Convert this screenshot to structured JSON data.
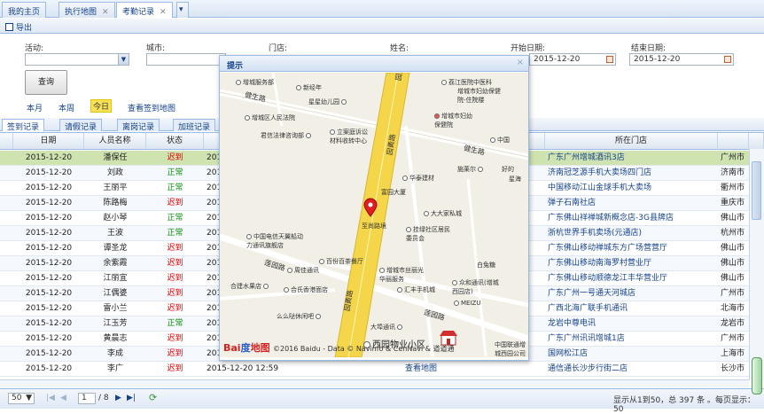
{
  "tabs": [
    {
      "label": "我的主页"
    },
    {
      "label": "执行地图"
    },
    {
      "label": "考勤记录"
    }
  ],
  "toolbar": {
    "export_label": "导出"
  },
  "filter": {
    "activity_label": "活动:",
    "city_label": "城市:",
    "store_label": "门店:",
    "name_label": "姓名:",
    "start_label": "开始日期:",
    "start_value": "2015-12-20",
    "end_label": "结束日期:",
    "end_value": "2015-12-20",
    "query_label": "查询",
    "month_link": "本月",
    "week_link": "本周",
    "today_link": "今日",
    "map_link": "查看签到地图"
  },
  "subtabs": [
    {
      "label": "签到记录"
    },
    {
      "label": "请假记录"
    },
    {
      "label": "离岗记录"
    },
    {
      "label": "加班记录"
    }
  ],
  "grid": {
    "columns": [
      "日期",
      "人员名称",
      "状态",
      "",
      "所在门店"
    ],
    "rows": [
      {
        "date": "2015-12-20",
        "name": "潘保任",
        "status": "迟到",
        "time": "201",
        "store": "广东广州增城酒讯3店",
        "city": "广州市"
      },
      {
        "date": "2015-12-20",
        "name": "刘政",
        "status": "正常",
        "time": "201",
        "store": "济南冠芝源手机大卖场四门店",
        "city": "济南市"
      },
      {
        "date": "2015-12-20",
        "name": "王丽平",
        "status": "正常",
        "time": "201",
        "store": "中国移动江山金球手机大卖场",
        "city": "衢州市"
      },
      {
        "date": "2015-12-20",
        "name": "陈路梅",
        "status": "迟到",
        "time": "201",
        "store": "弹子石南社店",
        "city": "重庆市"
      },
      {
        "date": "2015-12-20",
        "name": "赵小琴",
        "status": "正常",
        "time": "201",
        "store": "广东佛山祥禅城新概念店-3G县牌店",
        "city": "佛山市"
      },
      {
        "date": "2015-12-20",
        "name": "王波",
        "status": "正常",
        "time": "201",
        "store": "浙杭世界手机卖场(元通店)",
        "city": "杭州市"
      },
      {
        "date": "2015-12-20",
        "name": "谭圣龙",
        "status": "迟到",
        "time": "201",
        "store": "广东佛山移动禅城东方广场营营厅",
        "city": "佛山市"
      },
      {
        "date": "2015-12-20",
        "name": "余紫霞",
        "status": "迟到",
        "time": "201",
        "store": "广东佛山移动南海罗村营业厅",
        "city": "佛山市"
      },
      {
        "date": "2015-12-20",
        "name": "江丽宜",
        "status": "迟到",
        "time": "201",
        "store": "广东佛山移动顺德龙江丰华营业厅",
        "city": "佛山市"
      },
      {
        "date": "2015-12-20",
        "name": "江偶婆",
        "status": "迟到",
        "time": "201",
        "store": "广东广州一号通天河城店",
        "city": "广州市"
      },
      {
        "date": "2015-12-20",
        "name": "雷小兰",
        "status": "迟到",
        "time": "201",
        "store": "广西北海广联手机通讯",
        "city": "北海市"
      },
      {
        "date": "2015-12-20",
        "name": "江玉芳",
        "status": "正常",
        "time": "201",
        "store": "龙岩中尊电讯",
        "city": "龙岩市"
      },
      {
        "date": "2015-12-20",
        "name": "黄晨志",
        "status": "迟到",
        "time": "201",
        "store": "广东广州讯讯增城1店",
        "city": "广州市"
      },
      {
        "date": "2015-12-20",
        "name": "李成",
        "status": "迟到",
        "time": "201",
        "store": "国网松江店",
        "city": "上海市"
      },
      {
        "date": "2015-12-20",
        "name": "李广",
        "status": "迟到",
        "time": "2015-12-20 12:59",
        "link": "查看地图",
        "store": "通信通长沙步行街二店",
        "city": "长沙市"
      }
    ]
  },
  "pager": {
    "page_size": "50",
    "page_input": "1",
    "page_total": "/ 8",
    "summary": "显示从1到50，总 397 条 。每页显示：50"
  },
  "dialog": {
    "title": "提示",
    "close": "×"
  },
  "map": {
    "roads": [
      "园黄路",
      "健生路",
      "园黄路",
      "健生路",
      "莲园路",
      "园黄路",
      "莲园路"
    ],
    "pois": [
      "增城服务部",
      "新经年",
      "荔江医院中医科",
      "增城市妇幼保健院-住院楼",
      "星星幼儿园",
      "增城区人民法院",
      "增城市妇幼保健院",
      "君信法律咨询部",
      "立案庭诉讼材料收转中心",
      "中国",
      "施莱尔",
      "好的",
      "星海",
      "华泰建材",
      "富园大厦",
      "大大家私城",
      "至尚路境",
      "挂绿社区居民委员会",
      "中国电信天翼船动力通讯旗舰店",
      "百份百茶餐厅",
      "白兔糖",
      "周佳通讯",
      "增城市丝丽光华丽服务",
      "合建水果店",
      "合氏香港面店",
      "汇丰手机城",
      "众和通讯(增城西园店)",
      "MEIZU",
      "么么哒休闲吧",
      "大埠通讯",
      "西园物业小区",
      "中国联通增城西园公司营业厅"
    ],
    "poi_main": "西园物业小区",
    "copyright": "©2016 Baidu - Data © Navinfo & CenNavi & 道道通",
    "logo": "Bai度地图"
  },
  "colors": {
    "accent": "#15428b",
    "late": "#dd0000",
    "normal": "#0a8a0a",
    "selected_row": "#cfe3b0",
    "road": "#f5d64a"
  }
}
